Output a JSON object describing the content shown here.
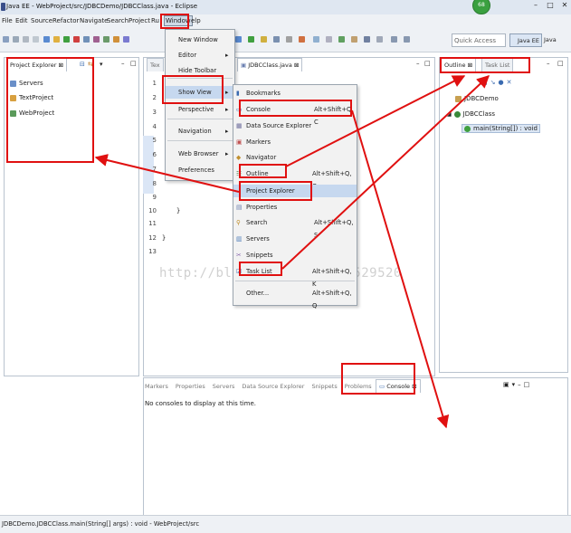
{
  "window": {
    "title": "Java EE - WebProject/src/JDBCDemo/JDBCClass.java - Eclipse",
    "badge": "68"
  },
  "menubar": [
    "File",
    "Edit",
    "Source",
    "Refactor",
    "Navigate",
    "Search",
    "Project",
    "Ru",
    "Window",
    "elp"
  ],
  "toolbar": {
    "quick_access_placeholder": "Quick Access",
    "perspectives": [
      "Java EE",
      "Java"
    ]
  },
  "project_explorer": {
    "tab_label": "Project Explorer",
    "items": [
      "Servers",
      "TextProject",
      "WebProject"
    ]
  },
  "editor": {
    "tab_partial": "Tex",
    "tab_label": "JDBCClass.java",
    "line_numbers": [
      "1",
      "2",
      "3",
      "4",
      "5",
      "6",
      "7",
      "8",
      "9",
      "10",
      "11",
      "12",
      "13"
    ],
    "code_lines": [
      "}",
      "}"
    ]
  },
  "outline": {
    "tab_label": "Outline",
    "tab2_label": "Task List",
    "items": [
      "JDBCDemo",
      "JDBCClass",
      "main(String[]) : void"
    ]
  },
  "window_menu": {
    "items": [
      "New Window",
      "Editor",
      "Hide Toolbar",
      "Show View",
      "Perspective",
      "Navigation",
      "Web Browser",
      "Preferences"
    ]
  },
  "show_view_menu": {
    "items": [
      {
        "label": "Bookmarks",
        "accel": ""
      },
      {
        "label": "Console",
        "accel": "Alt+Shift+Q, C"
      },
      {
        "label": "Data Source Explorer",
        "accel": ""
      },
      {
        "label": "Markers",
        "accel": ""
      },
      {
        "label": "Navigator",
        "accel": ""
      },
      {
        "label": "Outline",
        "accel": "Alt+Shift+Q, O"
      },
      {
        "label": "Project Explorer",
        "accel": ""
      },
      {
        "label": "Properties",
        "accel": ""
      },
      {
        "label": "Search",
        "accel": "Alt+Shift+Q, S"
      },
      {
        "label": "Servers",
        "accel": ""
      },
      {
        "label": "Snippets",
        "accel": ""
      },
      {
        "label": "Task List",
        "accel": "Alt+Shift+Q, K"
      },
      {
        "label": "Other...",
        "accel": "Alt+Shift+Q, Q"
      }
    ]
  },
  "bottom_panel": {
    "tabs": [
      "Markers",
      "Properties",
      "Servers",
      "Data Source Explorer",
      "Snippets",
      "Problems",
      "Console"
    ],
    "message": "No consoles to display at this time."
  },
  "watermark": "http://blog.csdn.net/hyp529520",
  "status": "JDBCDemo.JDBCClass.main(String[] args) : void - WebProject/src",
  "colors": {
    "annotation_red": "#e01010",
    "selection": "#c6d8ef",
    "chrome": "#eef1f5"
  }
}
